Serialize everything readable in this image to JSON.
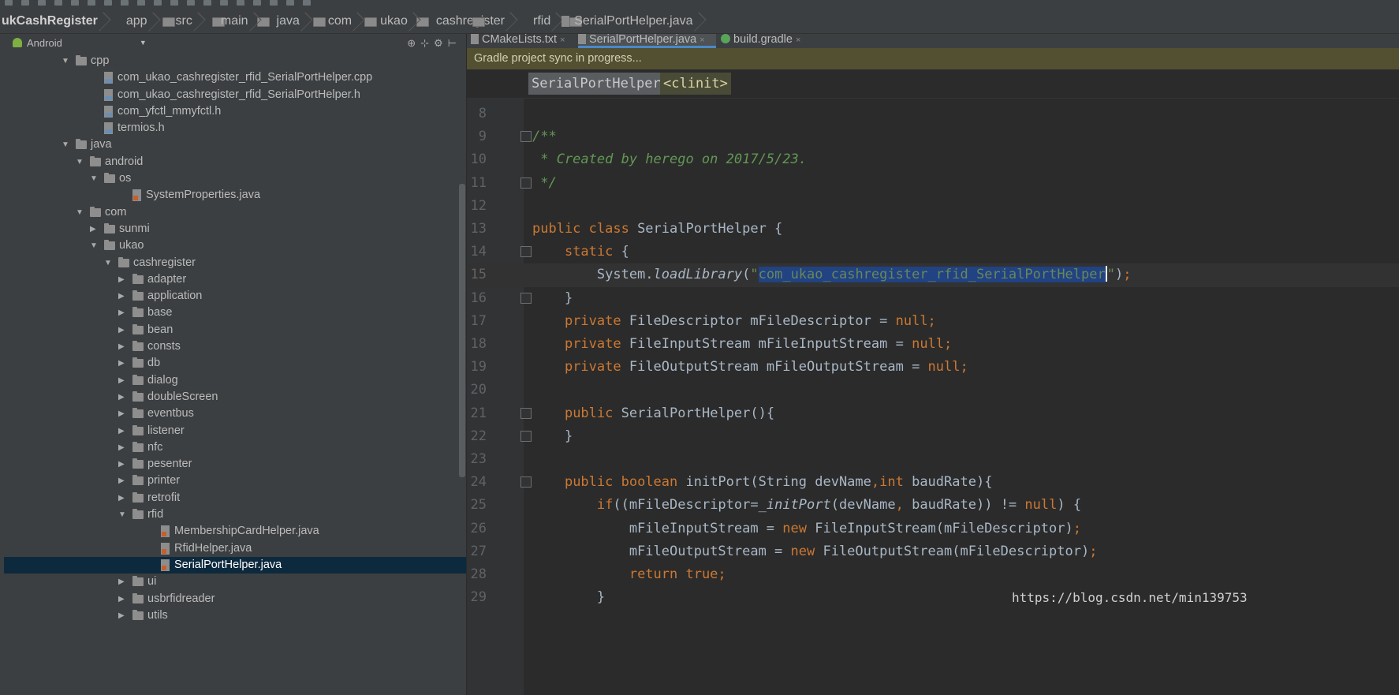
{
  "breadcrumb": [
    "ukCashRegister",
    "app",
    "src",
    "main",
    "java",
    "com",
    "ukao",
    "cashregister",
    "rfid",
    "SerialPortHelper.java"
  ],
  "project_panel": {
    "view_mode": "Android",
    "tree": [
      {
        "label": "cpp",
        "type": "folder",
        "depth": 2,
        "expanded": true
      },
      {
        "label": "com_ukao_cashregister_rfid_SerialPortHelper.cpp",
        "type": "cfile",
        "depth": 3
      },
      {
        "label": "com_ukao_cashregister_rfid_SerialPortHelper.h",
        "type": "cfile",
        "depth": 3
      },
      {
        "label": "com_yfctl_mmyfctl.h",
        "type": "cfile",
        "depth": 3
      },
      {
        "label": "termios.h",
        "type": "cfile",
        "depth": 3
      },
      {
        "label": "java",
        "type": "folder",
        "depth": 2,
        "expanded": true
      },
      {
        "label": "android",
        "type": "folder",
        "depth": 3,
        "expanded": true
      },
      {
        "label": "os",
        "type": "folder",
        "depth": 4,
        "expanded": true
      },
      {
        "label": "SystemProperties.java",
        "type": "java",
        "depth": 5
      },
      {
        "label": "com",
        "type": "folder",
        "depth": 3,
        "expanded": true
      },
      {
        "label": "sunmi",
        "type": "folder",
        "depth": 4,
        "expanded": false
      },
      {
        "label": "ukao",
        "type": "folder",
        "depth": 4,
        "expanded": true
      },
      {
        "label": "cashregister",
        "type": "folder",
        "depth": 5,
        "expanded": true
      },
      {
        "label": "adapter",
        "type": "folder",
        "depth": 6,
        "expanded": false
      },
      {
        "label": "application",
        "type": "folder",
        "depth": 6,
        "expanded": false
      },
      {
        "label": "base",
        "type": "folder",
        "depth": 6,
        "expanded": false
      },
      {
        "label": "bean",
        "type": "folder",
        "depth": 6,
        "expanded": false
      },
      {
        "label": "consts",
        "type": "folder",
        "depth": 6,
        "expanded": false
      },
      {
        "label": "db",
        "type": "folder",
        "depth": 6,
        "expanded": false
      },
      {
        "label": "dialog",
        "type": "folder",
        "depth": 6,
        "expanded": false
      },
      {
        "label": "doubleScreen",
        "type": "folder",
        "depth": 6,
        "expanded": false
      },
      {
        "label": "eventbus",
        "type": "folder",
        "depth": 6,
        "expanded": false
      },
      {
        "label": "listener",
        "type": "folder",
        "depth": 6,
        "expanded": false
      },
      {
        "label": "nfc",
        "type": "folder",
        "depth": 6,
        "expanded": false
      },
      {
        "label": "pesenter",
        "type": "folder",
        "depth": 6,
        "expanded": false
      },
      {
        "label": "printer",
        "type": "folder",
        "depth": 6,
        "expanded": false
      },
      {
        "label": "retrofit",
        "type": "folder",
        "depth": 6,
        "expanded": false
      },
      {
        "label": "rfid",
        "type": "folder",
        "depth": 6,
        "expanded": true
      },
      {
        "label": "MembershipCardHelper.java",
        "type": "java",
        "depth": 7
      },
      {
        "label": "RfidHelper.java",
        "type": "java",
        "depth": 7
      },
      {
        "label": "SerialPortHelper.java",
        "type": "java",
        "depth": 7,
        "selected": true
      },
      {
        "label": "ui",
        "type": "folder",
        "depth": 6,
        "expanded": false
      },
      {
        "label": "usbrfidreader",
        "type": "folder",
        "depth": 6,
        "expanded": false
      },
      {
        "label": "utils",
        "type": "folder",
        "depth": 6,
        "expanded": false
      }
    ]
  },
  "tabs": [
    {
      "label": "CMakeLists.txt",
      "icon": "text-file-icon",
      "active": false
    },
    {
      "label": "SerialPortHelper.java",
      "icon": "java-file-icon",
      "active": true
    },
    {
      "label": "build.gradle",
      "icon": "gradle-icon",
      "active": false
    }
  ],
  "notification": "Gradle project sync in progress...",
  "scope": {
    "class": "SerialPortHelper",
    "member": "<clinit>"
  },
  "code_lines": [
    {
      "n": "8",
      "html": ""
    },
    {
      "n": "9",
      "html": "<span class='cm'>/**</span>",
      "fold": true
    },
    {
      "n": "10",
      "html": "<span class='cm'> * Created by herego on 2017/5/23.</span>"
    },
    {
      "n": "11",
      "html": "<span class='cm'> */</span>",
      "fold": true
    },
    {
      "n": "12",
      "html": ""
    },
    {
      "n": "13",
      "html": "<span class='kw'>public class </span>SerialPortHelper {"
    },
    {
      "n": "14",
      "html": "    <span class='kw'>static </span>{",
      "fold": true
    },
    {
      "n": "15",
      "html": "        System.<i>loadLibrary</i>(<span class='str'>\"</span><span class='sel-str'>com_ukao_cashregister_rfid_SerialPortHelper</span><span class='caret'></span><span class='str'>\"</span>)<span class='kw'>;</span>",
      "current": true
    },
    {
      "n": "16",
      "html": "    }",
      "fold": true
    },
    {
      "n": "17",
      "html": "    <span class='kw'>private </span>FileDescriptor mFileDescriptor = <span class='kw'>null;</span>"
    },
    {
      "n": "18",
      "html": "    <span class='kw'>private </span>FileInputStream mFileInputStream = <span class='kw'>null;</span>"
    },
    {
      "n": "19",
      "html": "    <span class='kw'>private </span>FileOutputStream mFileOutputStream = <span class='kw'>null;</span>"
    },
    {
      "n": "20",
      "html": ""
    },
    {
      "n": "21",
      "html": "    <span class='kw'>public </span>SerialPortHelper(){",
      "fold": true
    },
    {
      "n": "22",
      "html": "    }",
      "fold": true
    },
    {
      "n": "23",
      "html": ""
    },
    {
      "n": "24",
      "html": "    <span class='kw'>public boolean </span>initPort(String devName<span class='kw'>,int </span>baudRate){",
      "fold": true
    },
    {
      "n": "25",
      "html": "        <span class='kw'>if</span>((mFileDescriptor=<i>_initPort</i>(devName<span class='kw'>, </span>baudRate)) != <span class='kw'>null</span>) {"
    },
    {
      "n": "26",
      "html": "            mFileInputStream = <span class='kw'>new </span>FileInputStream(mFileDescriptor)<span class='kw'>;</span>"
    },
    {
      "n": "27",
      "html": "            mFileOutputStream = <span class='kw'>new </span>FileOutputStream(mFileDescriptor)<span class='kw'>;</span>"
    },
    {
      "n": "28",
      "html": "            <span class='kw'>return true;</span>"
    },
    {
      "n": "29",
      "html": "        }"
    }
  ],
  "watermark": "https://blog.csdn.net/min139753"
}
